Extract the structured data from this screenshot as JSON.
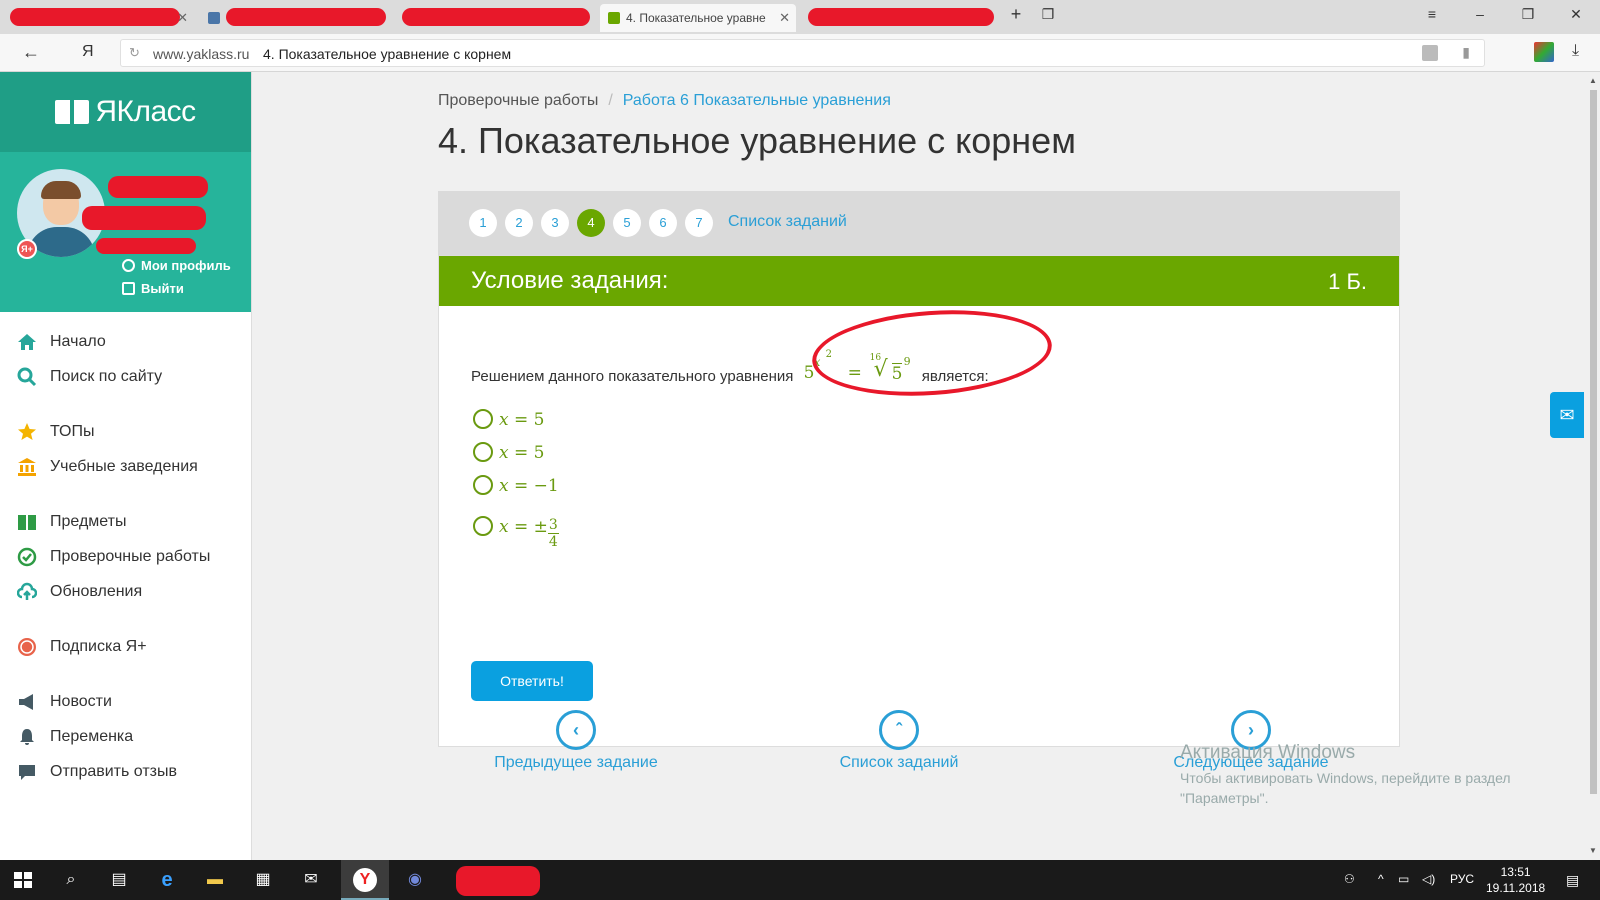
{
  "browser": {
    "tabs": [
      {
        "label": "",
        "redacted": true
      },
      {
        "label": "",
        "redacted": true
      },
      {
        "label": "",
        "redacted": true
      },
      {
        "label": "4. Показательное уравне",
        "active": true
      },
      {
        "label": "",
        "redacted": true
      }
    ],
    "address": {
      "domain": "www.yaklass.ru",
      "page_title": "4. Показательное уравнение с корнем"
    }
  },
  "sidebar": {
    "logo": "ЯКласс",
    "profile": {
      "my_profile": "Мои профиль",
      "logout": "Выйти"
    },
    "menu": [
      {
        "label": "Начало",
        "icon": "home-icon"
      },
      {
        "label": "Поиск по сайту",
        "icon": "search-icon"
      },
      {
        "label": "ТОПы",
        "icon": "star-icon"
      },
      {
        "label": "Учебные заведения",
        "icon": "building-icon"
      },
      {
        "label": "Предметы",
        "icon": "book-icon"
      },
      {
        "label": "Проверочные работы",
        "icon": "check-icon"
      },
      {
        "label": "Обновления",
        "icon": "cloud-icon"
      },
      {
        "label": "Подписка Я+",
        "icon": "ya-plus-icon"
      },
      {
        "label": "Новости",
        "icon": "megaphone-icon"
      },
      {
        "label": "Переменка",
        "icon": "bell-icon"
      },
      {
        "label": "Отправить отзыв",
        "icon": "comment-icon"
      }
    ]
  },
  "main": {
    "breadcrumb": {
      "item1": "Проверочные работы",
      "separator": "/",
      "item2": "Работа 6 Показательные уравнения"
    },
    "title": "4. Показательное уравнение с корнем",
    "task_numbers": [
      "1",
      "2",
      "3",
      "4",
      "5",
      "6",
      "7"
    ],
    "current_task": "4",
    "task_list_link": "Список заданий",
    "card": {
      "header": "Условие задания:",
      "points": "1 Б.",
      "question_before": "Решением данного показательного уравнения",
      "question_after": "является:",
      "formula": {
        "base": "5",
        "exp_var": "x",
        "exp_pow": "2",
        "eq": "=",
        "root_index": "16",
        "radicand_base": "5",
        "radicand_exp": "9"
      },
      "options": [
        {
          "var": "x",
          "rest": "= 5"
        },
        {
          "var": "x",
          "rest": "= 5"
        },
        {
          "var": "x",
          "rest": "= −1"
        },
        {
          "var": "x",
          "rest": "= ±",
          "frac_num": "3",
          "frac_den": "4"
        }
      ],
      "submit": "Ответить!"
    },
    "nav": {
      "prev": "Предыдущее задание",
      "list": "Список заданий",
      "next": "Следующее задание"
    },
    "watermark": {
      "line1": "Активация Windows",
      "line2": "Чтобы активировать Windows, перейдите в раздел",
      "line3": "\"Параметры\"."
    }
  },
  "taskbar": {
    "lang": "РУС",
    "time": "13:51",
    "date": "19.11.2018"
  },
  "colors": {
    "brand_teal": "#1f9e86",
    "green": "#6aa700",
    "link_blue": "#2a9fd6",
    "button_blue": "#0aa0e0",
    "red_mark": "#e8182a"
  }
}
